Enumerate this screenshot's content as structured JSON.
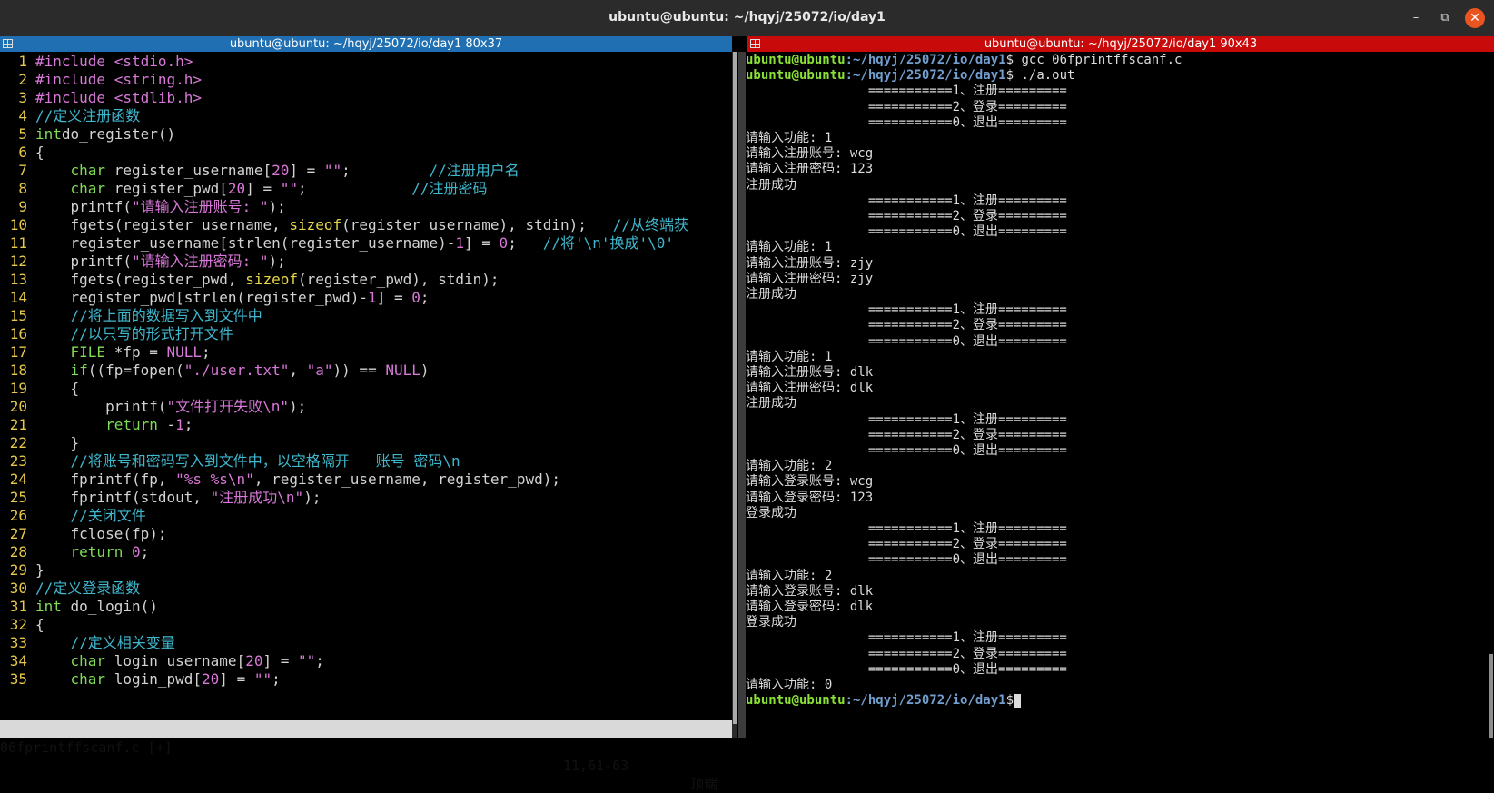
{
  "window": {
    "title": "ubuntu@ubuntu: ~/hqyj/25072/io/day1",
    "minimize": "–",
    "maximize": "⧉",
    "close": "✕"
  },
  "left_pane": {
    "header": "ubuntu@ubuntu: ~/hqyj/25072/io/day1 80x37",
    "status": {
      "file": "06fprintffscanf.c [+]",
      "position": "11,61-63",
      "scroll": "顶端"
    },
    "lines": [
      {
        "n": "1",
        "tokens": [
          [
            "pp",
            "#include "
          ],
          [
            "str",
            "<stdio.h>"
          ]
        ]
      },
      {
        "n": "2",
        "tokens": [
          [
            "pp",
            "#include "
          ],
          [
            "str",
            "<string.h>"
          ]
        ]
      },
      {
        "n": "3",
        "tokens": [
          [
            "pp",
            "#include "
          ],
          [
            "str",
            "<stdlib.h>"
          ]
        ]
      },
      {
        "n": "4",
        "tokens": [
          [
            "cm",
            "//定义注册函数"
          ]
        ]
      },
      {
        "n": "5",
        "tokens": [
          [
            "ty",
            "int"
          ],
          [
            "",
            "do_register()"
          ]
        ]
      },
      {
        "n": "6",
        "tokens": [
          [
            "",
            "{"
          ]
        ]
      },
      {
        "n": "7",
        "tokens": [
          [
            "",
            "    "
          ],
          [
            "ty",
            "char"
          ],
          [
            "",
            " register_username["
          ],
          [
            "num",
            "20"
          ],
          [
            "",
            "] = "
          ],
          [
            "str",
            "\"\""
          ],
          [
            "",
            ";         "
          ],
          [
            "cm",
            "//注册用户名"
          ]
        ]
      },
      {
        "n": "8",
        "tokens": [
          [
            "",
            "    "
          ],
          [
            "ty",
            "char"
          ],
          [
            "",
            " register_pwd["
          ],
          [
            "num",
            "20"
          ],
          [
            "",
            "] = "
          ],
          [
            "str",
            "\"\""
          ],
          [
            "",
            ";            "
          ],
          [
            "cm",
            "//注册密码"
          ]
        ]
      },
      {
        "n": "9",
        "tokens": [
          [
            "",
            "    printf("
          ],
          [
            "str",
            "\"请输入注册账号: \""
          ],
          [
            "",
            ");"
          ]
        ]
      },
      {
        "n": "10",
        "tokens": [
          [
            "",
            "    fgets(register_username, "
          ],
          [
            "fn",
            "sizeof"
          ],
          [
            "",
            "(register_username), stdin);   "
          ],
          [
            "cm",
            "//从终端获"
          ]
        ]
      },
      {
        "n": "11",
        "tokens": [
          [
            "",
            "    register_username[strlen(register_username)-"
          ],
          [
            "num",
            "1"
          ],
          [
            "",
            "] = "
          ],
          [
            "num",
            "0"
          ],
          [
            "",
            ";   "
          ],
          [
            "cm",
            "//将'\\n'换成'\\0'"
          ]
        ]
      },
      {
        "n": "12",
        "tokens": [
          [
            "",
            "    printf("
          ],
          [
            "str",
            "\"请输入注册密码: \""
          ],
          [
            "",
            ");"
          ]
        ]
      },
      {
        "n": "13",
        "tokens": [
          [
            "",
            "    fgets(register_pwd, "
          ],
          [
            "fn",
            "sizeof"
          ],
          [
            "",
            "(register_pwd), stdin);"
          ]
        ]
      },
      {
        "n": "14",
        "tokens": [
          [
            "",
            "    register_pwd[strlen(register_pwd)-"
          ],
          [
            "num",
            "1"
          ],
          [
            "",
            "] = "
          ],
          [
            "num",
            "0"
          ],
          [
            "",
            ";"
          ]
        ]
      },
      {
        "n": "15",
        "tokens": [
          [
            "",
            "    "
          ],
          [
            "cm",
            "//将上面的数据写入到文件中"
          ]
        ]
      },
      {
        "n": "16",
        "tokens": [
          [
            "",
            "    "
          ],
          [
            "cm",
            "//以只写的形式打开文件"
          ]
        ]
      },
      {
        "n": "17",
        "tokens": [
          [
            "",
            "    "
          ],
          [
            "ty",
            "FILE"
          ],
          [
            "",
            " *fp = "
          ],
          [
            "num",
            "NULL"
          ],
          [
            "",
            ";"
          ]
        ]
      },
      {
        "n": "18",
        "tokens": [
          [
            "",
            "    "
          ],
          [
            "kw",
            "if"
          ],
          [
            "",
            "((fp=fopen("
          ],
          [
            "str",
            "\"./user.txt\""
          ],
          [
            "",
            ", "
          ],
          [
            "str",
            "\"a\""
          ],
          [
            "",
            "))"
          ],
          [
            "",
            " == "
          ],
          [
            "num",
            "NULL"
          ],
          [
            "",
            ")"
          ]
        ]
      },
      {
        "n": "19",
        "tokens": [
          [
            "",
            "    {"
          ]
        ]
      },
      {
        "n": "20",
        "tokens": [
          [
            "",
            "        printf("
          ],
          [
            "str",
            "\"文件打开失败\\n\""
          ],
          [
            "",
            ");"
          ]
        ]
      },
      {
        "n": "21",
        "tokens": [
          [
            "",
            "        "
          ],
          [
            "kw",
            "return"
          ],
          [
            "",
            " -"
          ],
          [
            "num",
            "1"
          ],
          [
            "",
            ";"
          ]
        ]
      },
      {
        "n": "22",
        "tokens": [
          [
            "",
            "    }"
          ]
        ]
      },
      {
        "n": "23",
        "tokens": [
          [
            "",
            "    "
          ],
          [
            "cm",
            "//将账号和密码写入到文件中，以空格隔开   账号 密码\\n"
          ]
        ]
      },
      {
        "n": "24",
        "tokens": [
          [
            "",
            "    fprintf(fp, "
          ],
          [
            "str",
            "\"%s %s\\n\""
          ],
          [
            "",
            ", register_username, register_pwd);"
          ]
        ]
      },
      {
        "n": "25",
        "tokens": [
          [
            "",
            "    fprintf(stdout, "
          ],
          [
            "str",
            "\"注册成功\\n\""
          ],
          [
            "",
            ");"
          ]
        ]
      },
      {
        "n": "26",
        "tokens": [
          [
            "",
            "    "
          ],
          [
            "cm",
            "//关闭文件"
          ]
        ]
      },
      {
        "n": "27",
        "tokens": [
          [
            "",
            "    fclose(fp);"
          ]
        ]
      },
      {
        "n": "28",
        "tokens": [
          [
            "",
            "    "
          ],
          [
            "kw",
            "return"
          ],
          [
            "",
            " "
          ],
          [
            "num",
            "0"
          ],
          [
            "",
            ";"
          ]
        ]
      },
      {
        "n": "29",
        "tokens": [
          [
            "",
            "}"
          ]
        ]
      },
      {
        "n": "30",
        "tokens": [
          [
            "cm",
            "//定义登录函数"
          ]
        ]
      },
      {
        "n": "31",
        "tokens": [
          [
            "ty",
            "int"
          ],
          [
            "",
            " do_login()"
          ]
        ]
      },
      {
        "n": "32",
        "tokens": [
          [
            "",
            "{"
          ]
        ]
      },
      {
        "n": "33",
        "tokens": [
          [
            "",
            "    "
          ],
          [
            "cm",
            "//定义相关变量"
          ]
        ]
      },
      {
        "n": "34",
        "tokens": [
          [
            "",
            "    "
          ],
          [
            "ty",
            "char"
          ],
          [
            "",
            " login_username["
          ],
          [
            "num",
            "20"
          ],
          [
            "",
            "] = "
          ],
          [
            "str",
            "\"\""
          ],
          [
            "",
            ";"
          ]
        ]
      },
      {
        "n": "35",
        "tokens": [
          [
            "",
            "    "
          ],
          [
            "ty",
            "char"
          ],
          [
            "",
            " login_pwd["
          ],
          [
            "num",
            "20"
          ],
          [
            "",
            "] = "
          ],
          [
            "str",
            "\"\""
          ],
          [
            "",
            ";"
          ]
        ]
      }
    ]
  },
  "right_pane": {
    "header": "ubuntu@ubuntu: ~/hqyj/25072/io/day1 90x43",
    "prompt_user": "ubuntu@ubuntu",
    "prompt_path": ":~/hqyj/25072/io/day1",
    "prompt_sym": "$",
    "lines": [
      {
        "type": "prompt",
        "cmd": " gcc 06fprintffscanf.c"
      },
      {
        "type": "prompt",
        "cmd": " ./a.out"
      },
      {
        "type": "out",
        "text": "                ===========1、注册========="
      },
      {
        "type": "out",
        "text": "                ===========2、登录========="
      },
      {
        "type": "out",
        "text": "                ===========0、退出========="
      },
      {
        "type": "out",
        "text": "请输入功能: 1"
      },
      {
        "type": "out",
        "text": "请输入注册账号: wcg"
      },
      {
        "type": "out",
        "text": "请输入注册密码: 123"
      },
      {
        "type": "out",
        "text": "注册成功"
      },
      {
        "type": "out",
        "text": "                ===========1、注册========="
      },
      {
        "type": "out",
        "text": "                ===========2、登录========="
      },
      {
        "type": "out",
        "text": "                ===========0、退出========="
      },
      {
        "type": "out",
        "text": "请输入功能: 1"
      },
      {
        "type": "out",
        "text": "请输入注册账号: zjy"
      },
      {
        "type": "out",
        "text": "请输入注册密码: zjy"
      },
      {
        "type": "out",
        "text": "注册成功"
      },
      {
        "type": "out",
        "text": "                ===========1、注册========="
      },
      {
        "type": "out",
        "text": "                ===========2、登录========="
      },
      {
        "type": "out",
        "text": "                ===========0、退出========="
      },
      {
        "type": "out",
        "text": "请输入功能: 1"
      },
      {
        "type": "out",
        "text": "请输入注册账号: dlk"
      },
      {
        "type": "out",
        "text": "请输入注册密码: dlk"
      },
      {
        "type": "out",
        "text": "注册成功"
      },
      {
        "type": "out",
        "text": "                ===========1、注册========="
      },
      {
        "type": "out",
        "text": "                ===========2、登录========="
      },
      {
        "type": "out",
        "text": "                ===========0、退出========="
      },
      {
        "type": "out",
        "text": "请输入功能: 2"
      },
      {
        "type": "out",
        "text": "请输入登录账号: wcg"
      },
      {
        "type": "out",
        "text": "请输入登录密码: 123"
      },
      {
        "type": "out",
        "text": "登录成功"
      },
      {
        "type": "out",
        "text": "                ===========1、注册========="
      },
      {
        "type": "out",
        "text": "                ===========2、登录========="
      },
      {
        "type": "out",
        "text": "                ===========0、退出========="
      },
      {
        "type": "out",
        "text": "请输入功能: 2"
      },
      {
        "type": "out",
        "text": "请输入登录账号: dlk"
      },
      {
        "type": "out",
        "text": "请输入登录密码: dlk"
      },
      {
        "type": "out",
        "text": "登录成功"
      },
      {
        "type": "out",
        "text": "                ===========1、注册========="
      },
      {
        "type": "out",
        "text": "                ===========2、登录========="
      },
      {
        "type": "out",
        "text": "                ===========0、退出========="
      },
      {
        "type": "out",
        "text": "请输入功能: 0"
      },
      {
        "type": "prompt",
        "cmd": "",
        "cursor": true
      }
    ]
  }
}
